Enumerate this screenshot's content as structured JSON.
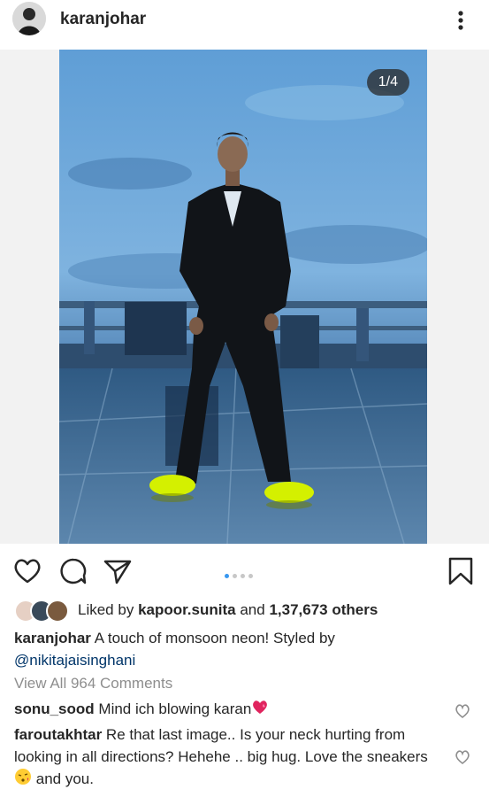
{
  "post": {
    "username": "karanjohar",
    "counter": "1/4",
    "carousel_total": 4,
    "carousel_active": 1
  },
  "likes": {
    "prefix": "Liked by",
    "liker": "kapoor.sunita",
    "and": "and",
    "count": "1,37,673 others"
  },
  "caption": {
    "author": "karanjohar",
    "text": "A touch of monsoon neon! Styled by",
    "mention": "@nikitajaisinghani"
  },
  "view_all": "View All 964 Comments",
  "comments": [
    {
      "author": "sonu_sood",
      "text": "Mind ich blowing karan",
      "emoji": "heart-icon"
    },
    {
      "author": "faroutakhtar",
      "text": "Re that last image.. Is your neck hurting from looking in all directions? Hehehe .. big hug. Love the sneakers",
      "text_after": "and you.",
      "emoji": "kiss-face-icon"
    }
  ],
  "colors": {
    "accent": "#3897f0",
    "text": "#262626",
    "muted": "#8e8e8e",
    "mention": "#003569",
    "neon": "#d4f000"
  }
}
